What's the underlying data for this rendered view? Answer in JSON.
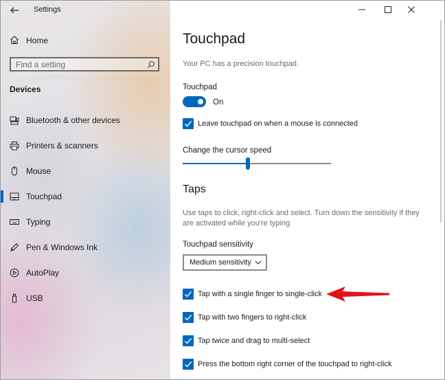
{
  "app": {
    "title": "Settings"
  },
  "sidebar": {
    "home_label": "Home",
    "search_placeholder": "Find a setting",
    "section_title": "Devices",
    "items": [
      {
        "label": "Bluetooth & other devices",
        "icon": "bluetooth-devices-icon"
      },
      {
        "label": "Printers & scanners",
        "icon": "printer-icon"
      },
      {
        "label": "Mouse",
        "icon": "mouse-icon"
      },
      {
        "label": "Touchpad",
        "icon": "touchpad-icon",
        "active": true
      },
      {
        "label": "Typing",
        "icon": "keyboard-icon"
      },
      {
        "label": "Pen & Windows Ink",
        "icon": "pen-icon"
      },
      {
        "label": "AutoPlay",
        "icon": "autoplay-icon"
      },
      {
        "label": "USB",
        "icon": "usb-icon"
      }
    ]
  },
  "main": {
    "title": "Touchpad",
    "subtitle": "Your PC has a precision touchpad.",
    "touchpad_label": "Touchpad",
    "toggle_state": "On",
    "leave_on_label": "Leave touchpad on when a mouse is connected",
    "cursor_speed_label": "Change the cursor speed",
    "cursor_speed_fraction": 0.44,
    "taps_heading": "Taps",
    "taps_description": "Use taps to click, right-click and select. Turn down the sensitivity if they are activated while you're typing",
    "sensitivity_label": "Touchpad sensitivity",
    "sensitivity_value": "Medium sensitivity",
    "checks": [
      "Tap with a single finger to single-click",
      "Tap with two fingers to right-click",
      "Tap twice and drag to multi-select",
      "Press the bottom right corner of the touchpad to right-click"
    ]
  },
  "colors": {
    "accent": "#0067c0",
    "annotation_arrow": "#e3141b"
  }
}
